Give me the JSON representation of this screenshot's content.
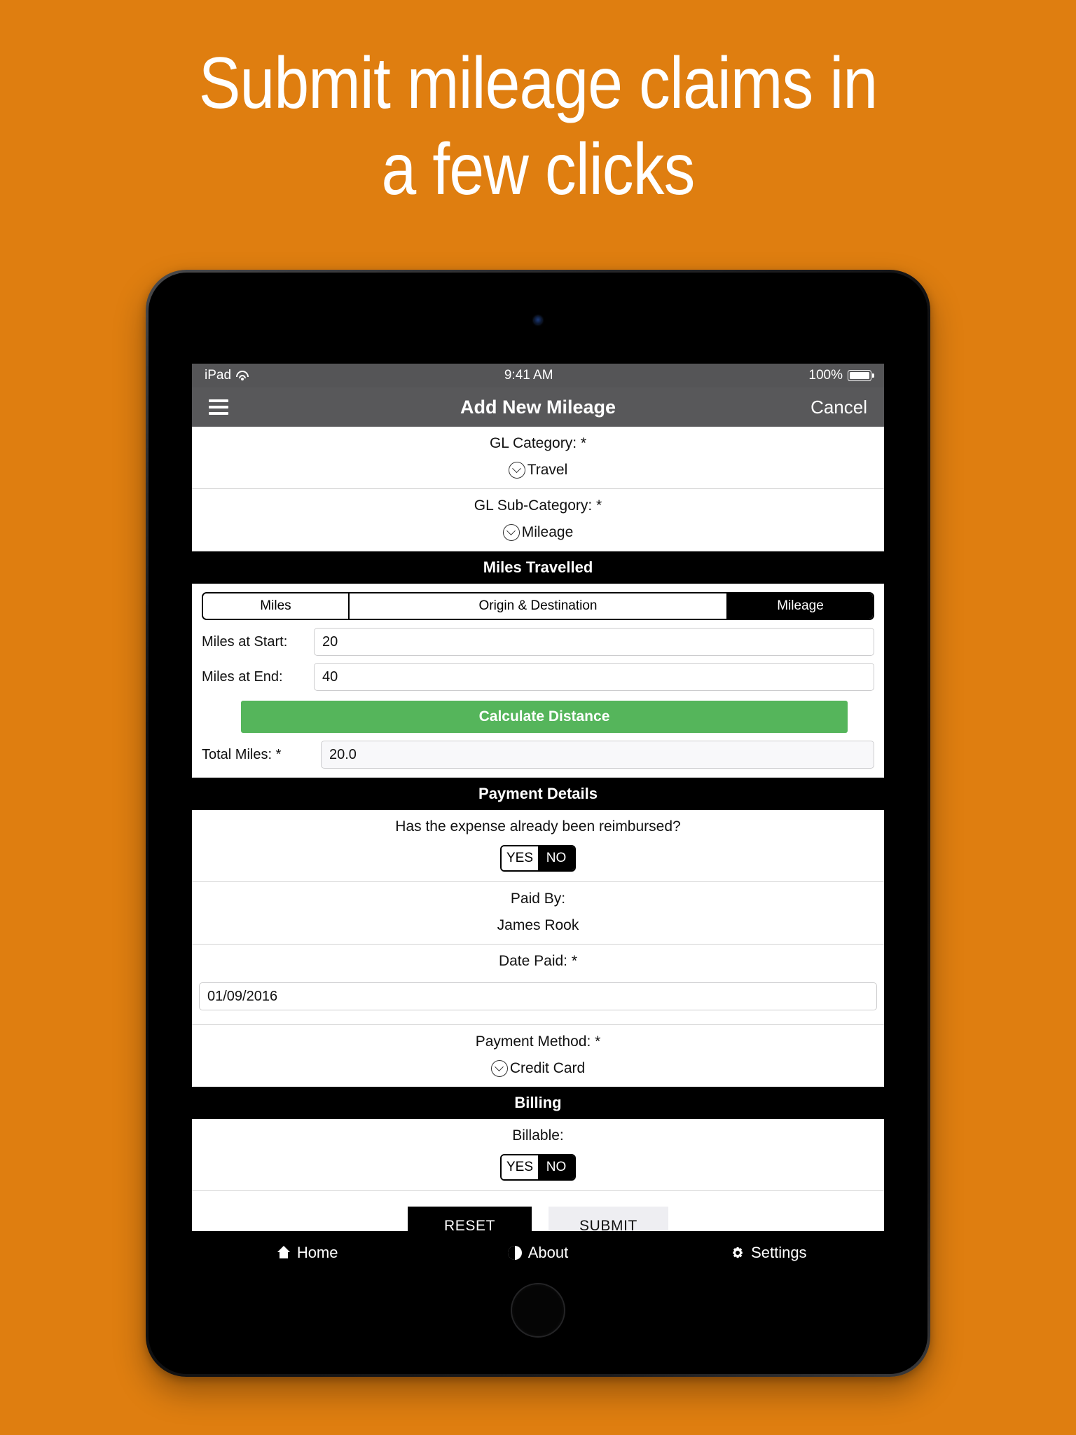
{
  "promo": {
    "headline_line1": "Submit mileage claims in",
    "headline_line2": "a few clicks",
    "background_color": "#DF7E10",
    "text_color": "#FFFFFF"
  },
  "status_bar": {
    "carrier": "iPad",
    "wifi_icon": "wifi-icon",
    "time": "9:41 AM",
    "battery_percent": "100%",
    "battery_icon": "battery-full-icon"
  },
  "nav_bar": {
    "menu_icon": "hamburger-menu-icon",
    "title": "Add New Mileage",
    "cancel_label": "Cancel"
  },
  "form": {
    "gl_category": {
      "label": "GL Category: *",
      "value": "Travel",
      "icon": "chevron-down-circle-icon"
    },
    "gl_sub_category": {
      "label": "GL Sub-Category: *",
      "value": "Mileage",
      "icon": "chevron-down-circle-icon"
    },
    "miles_travelled": {
      "section_title": "Miles Travelled",
      "segments": [
        {
          "label": "Miles",
          "active": false
        },
        {
          "label": "Origin & Destination",
          "active": false
        },
        {
          "label": "Mileage",
          "active": true
        }
      ],
      "miles_at_start": {
        "label": "Miles at Start:",
        "value": "20"
      },
      "miles_at_end": {
        "label": "Miles at End:",
        "value": "40"
      },
      "calculate_button": "Calculate Distance",
      "total_miles": {
        "label": "Total Miles: *",
        "value": "20.0"
      }
    },
    "payment_details": {
      "section_title": "Payment Details",
      "reimbursed_question": "Has the expense already been reimbursed?",
      "reimbursed_toggle": {
        "yes": "YES",
        "no": "NO",
        "selected": "NO"
      },
      "paid_by": {
        "label": "Paid By:",
        "value": "James Rook"
      },
      "date_paid": {
        "label": "Date Paid: *",
        "value": "01/09/2016"
      },
      "payment_method": {
        "label": "Payment Method: *",
        "value": "Credit Card",
        "icon": "chevron-down-circle-icon"
      }
    },
    "billing": {
      "section_title": "Billing",
      "billable_label": "Billable:",
      "billable_toggle": {
        "yes": "YES",
        "no": "NO",
        "selected": "NO"
      }
    },
    "actions": {
      "reset_label": "RESET",
      "submit_label": "SUBMIT"
    }
  },
  "tab_bar": {
    "items": [
      {
        "label": "Home",
        "icon": "home-icon"
      },
      {
        "label": "About",
        "icon": "info-circle-icon"
      },
      {
        "label": "Settings",
        "icon": "gear-icon"
      }
    ]
  },
  "colors": {
    "brand_orange": "#DF7E10",
    "calculate_green": "#55B55B",
    "section_black": "#000000",
    "navbar_gray": "#58585A"
  }
}
